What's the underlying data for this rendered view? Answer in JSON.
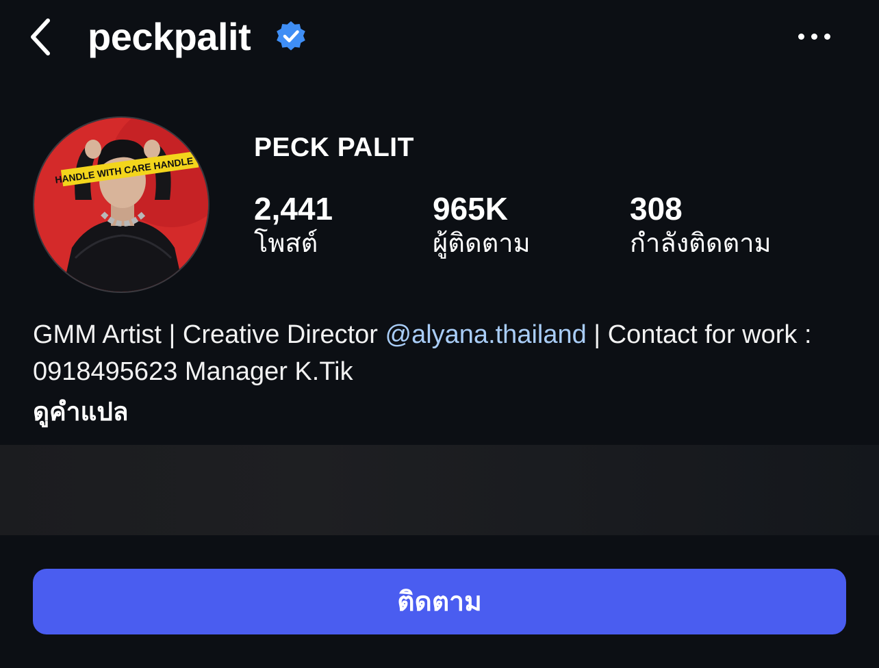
{
  "header": {
    "username": "peckpalit",
    "back_icon": "chevron-left-icon",
    "verified_icon": "verified-badge-icon",
    "more_icon": "more-horizontal-icon"
  },
  "profile": {
    "display_name": "PECK PALIT",
    "avatar_caption": "HANDLE WITH CARE  HANDLE W"
  },
  "stats": [
    {
      "value": "2,441",
      "label": "โพสต์"
    },
    {
      "value": "965K",
      "label": "ผู้ติดตาม"
    },
    {
      "value": "308",
      "label": "กำลังติดตาม"
    }
  ],
  "bio": {
    "text_before": "GMM Artist | Creative Director ",
    "mention": "@alyana.thailand",
    "text_after": " | Contact for work : 0918495623 Manager K.Tik",
    "translate_link": "ดูคำแปล"
  },
  "actions": {
    "follow_label": "ติดตาม"
  },
  "colors": {
    "background": "#0c0f14",
    "accent": "#4a5df0",
    "mention": "#a9cdf7",
    "verified": "#3f8ef5"
  }
}
